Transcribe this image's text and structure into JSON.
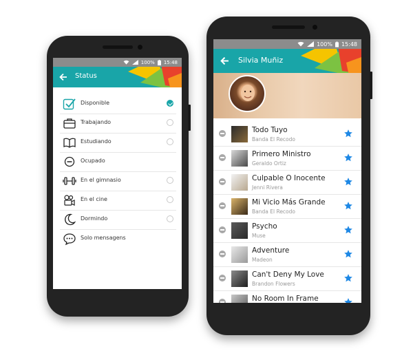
{
  "left_phone": {
    "status_bar": {
      "battery": "100%",
      "time": "15:48"
    },
    "app_bar": {
      "title": "Status"
    },
    "status_items": [
      {
        "label": "Disponible",
        "icon": "checkmark-icon",
        "selected": true
      },
      {
        "label": "Trabajando",
        "icon": "briefcase-icon",
        "selected": false
      },
      {
        "label": "Estudiando",
        "icon": "book-icon",
        "selected": false
      },
      {
        "label": "Ocupado",
        "icon": "do-not-disturb-icon",
        "selected": false
      },
      {
        "label": "En el gimnasio",
        "icon": "dumbbell-icon",
        "selected": false
      },
      {
        "label": "En el cine",
        "icon": "movie-camera-icon",
        "selected": false
      },
      {
        "label": "Dormindo",
        "icon": "moon-icon",
        "selected": false
      },
      {
        "label": "Solo mensagens",
        "icon": "chat-bubble-icon",
        "selected": false
      }
    ]
  },
  "right_phone": {
    "status_bar": {
      "battery": "100%",
      "time": "15:48"
    },
    "app_bar": {
      "title": "Silvia Muñiz"
    },
    "songs": [
      {
        "title": "Todo Tuyo",
        "artist": "Banda El Recodo"
      },
      {
        "title": "Primero Ministro",
        "artist": "Geraldo Ortiz"
      },
      {
        "title": "Culpable O Inocente",
        "artist": "Jenni Rivera"
      },
      {
        "title": "Mi Vicio Más Grande",
        "artist": "Banda El Recodo"
      },
      {
        "title": "Psycho",
        "artist": "Muse"
      },
      {
        "title": "Adventure",
        "artist": "Madeon"
      },
      {
        "title": "Can't Deny My Love",
        "artist": "Brandon Flowers"
      },
      {
        "title": "No Room In Frame",
        "artist": ""
      }
    ]
  },
  "colors": {
    "teal": "#19a5a8",
    "star_blue": "#1e88e5",
    "deco_yellow": "#f5c400",
    "deco_green": "#7cc242",
    "deco_red": "#e8412c",
    "deco_orange": "#f7941d"
  }
}
